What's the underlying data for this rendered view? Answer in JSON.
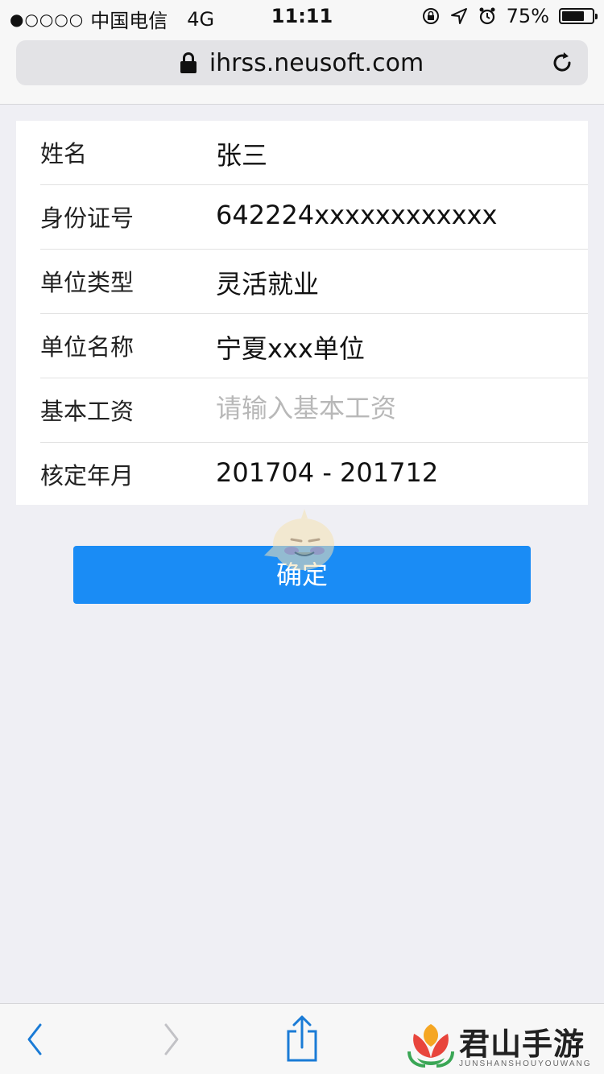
{
  "status_bar": {
    "signal": "●○○○○",
    "carrier": "中国电信",
    "network": "4G",
    "time": "11:11",
    "battery_percent": "75%",
    "battery_level": 0.75
  },
  "browser": {
    "url": "ihrss.neusoft.com",
    "secure_icon": "lock-icon",
    "reload_icon": "reload-icon"
  },
  "form": {
    "rows": [
      {
        "label": "姓名",
        "value": "张三"
      },
      {
        "label": "身份证号",
        "value": "642224xxxxxxxxxxxx"
      },
      {
        "label": "单位类型",
        "value": "灵活就业"
      },
      {
        "label": "单位名称",
        "value": "宁夏xxx单位"
      },
      {
        "label": "基本工资",
        "value": "",
        "placeholder": "请输入基本工资"
      },
      {
        "label": "核定年月",
        "value": "201704 - 201712"
      }
    ]
  },
  "actions": {
    "confirm_label": "确定"
  },
  "colors": {
    "accent": "#1a8cf5",
    "page_bg": "#efeff4",
    "toolbar_icon": "#1a7bd6"
  },
  "toolbar": {
    "icons": [
      "back-icon",
      "forward-icon",
      "share-icon",
      "bookmarks-icon",
      "tabs-icon"
    ]
  },
  "watermark": {
    "title": "君山手游网",
    "subtitle": "JUNSHANSHOUYOUWANG"
  }
}
